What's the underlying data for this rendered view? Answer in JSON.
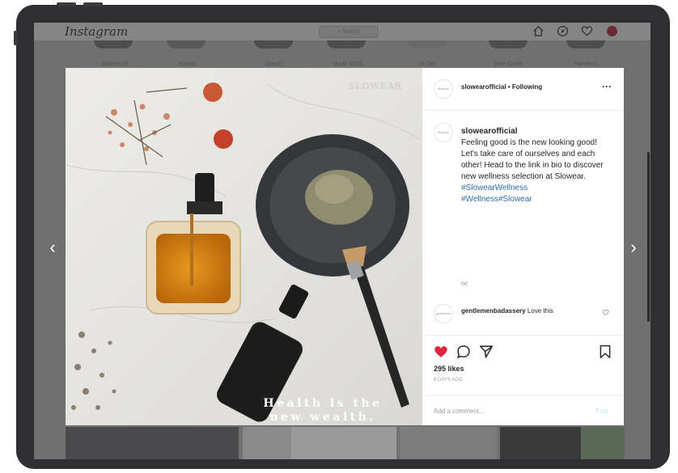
{
  "app": {
    "logo": "Instagram",
    "search_placeholder": "Search"
  },
  "stories": [
    "Slowear18",
    "Events",
    "Goods",
    "Made SS18",
    "On Set",
    "Style Guide",
    "Favorites"
  ],
  "post": {
    "photo_text_line1": "Health is the",
    "photo_text_line2": "new wealth.",
    "photo_watermark": "SLOWEAR",
    "account": "slowearofficial",
    "follow_label": "Following",
    "separator": "•",
    "more_label": "···",
    "avatar_label": "Slowear",
    "caption_user": "slowearofficial",
    "caption_text": "Feeling good is the new looking good! Let's take care of ourselves and each other! Head to the link in bio to discover new wellness selection at Slowear.",
    "hashtags": [
      "#SlowearWellness",
      "#Wellness#Slowear"
    ],
    "caption_age": "6d",
    "comment_avatar_label": "gentlemen",
    "comment_user": "gentlemenbadassery",
    "comment_text": "Love this",
    "likes": "295 likes",
    "time_ago": "6 DAYS AGO",
    "add_comment_placeholder": "Add a comment...",
    "post_button": "Post"
  },
  "colors": {
    "like_red": "#e0263d",
    "hashtag_blue": "#2b6ea8",
    "frame": "#2f2f31"
  },
  "icons": {
    "home": "home-icon",
    "explore": "compass-icon",
    "activity": "heart-icon",
    "profile": "avatar",
    "like": "heart-filled-icon",
    "comment": "comment-icon",
    "share": "send-icon",
    "save": "bookmark-icon",
    "prev": "chevron-left-icon",
    "next": "chevron-right-icon"
  }
}
